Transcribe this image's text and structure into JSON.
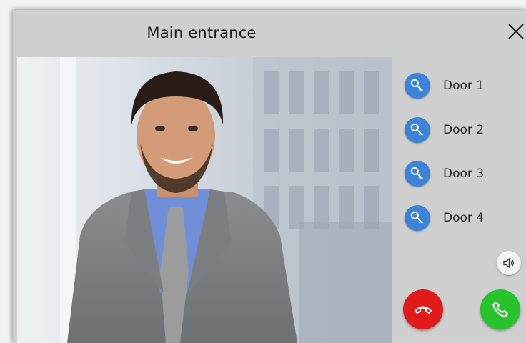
{
  "window": {
    "title": "Main entrance"
  },
  "doors": [
    {
      "label": "Door 1",
      "icon": "key-icon"
    },
    {
      "label": "Door 2",
      "icon": "key-icon"
    },
    {
      "label": "Door 3",
      "icon": "key-icon"
    },
    {
      "label": "Door 4",
      "icon": "key-icon"
    }
  ],
  "controls": {
    "speaker_icon": "speaker-icon",
    "hangup_icon": "hang-up-icon",
    "answer_icon": "phone-answer-icon"
  },
  "colors": {
    "key_button": "#3d84d8",
    "hangup": "#e11b1b",
    "answer": "#27c22c",
    "panel": "#cfcfcf"
  }
}
